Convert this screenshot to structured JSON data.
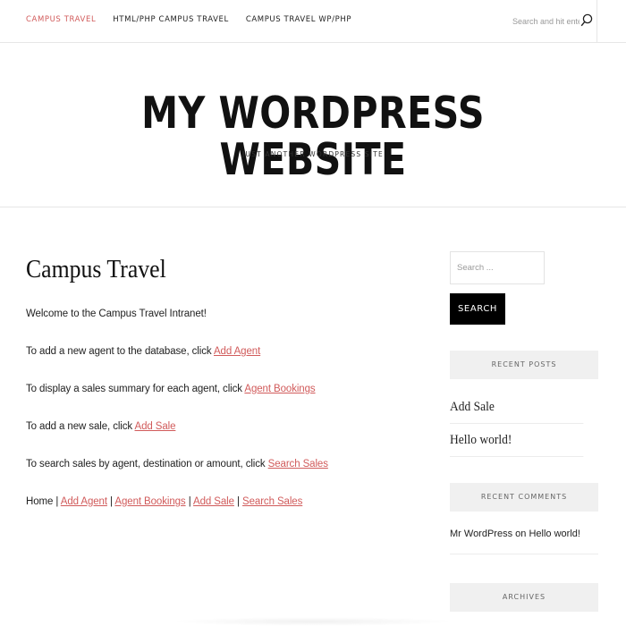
{
  "nav": {
    "items": [
      {
        "label": "CAMPUS TRAVEL",
        "active": true
      },
      {
        "label": "HTML/PHP CAMPUS TRAVEL",
        "active": false
      },
      {
        "label": "CAMPUS TRAVEL WP/PHP",
        "active": false
      }
    ],
    "search_placeholder": "Search and hit enter...",
    "search_icon": "search-icon"
  },
  "header": {
    "site_title": "MY WORDPRESS WEBSITE",
    "tagline": "JUST ANOTHER WORDPRESS SITE"
  },
  "main": {
    "title": "Campus Travel",
    "welcome": "Welcome to the Campus Travel Intranet!",
    "lines": [
      {
        "text": "To add a new agent to the database, click ",
        "link": "Add Agent"
      },
      {
        "text": "To display a sales summary for each agent, click ",
        "link": "Agent Bookings"
      },
      {
        "text": "To add a new sale, click ",
        "link": "Add Sale"
      },
      {
        "text": "To search sales by agent, destination or amount, click ",
        "link": "Search Sales"
      }
    ],
    "footer_nav": {
      "home": "Home",
      "separator": "|",
      "links": [
        "Add Agent",
        "Agent Bookings",
        "Add Sale",
        "Search Sales"
      ]
    }
  },
  "sidebar": {
    "search_placeholder": "Search ...",
    "search_button": "SEARCH",
    "recent_posts_title": "RECENT POSTS",
    "recent_posts": [
      "Add Sale",
      "Hello world!"
    ],
    "recent_comments_title": "RECENT COMMENTS",
    "comment": {
      "author": "Mr WordPress",
      "on": "on",
      "post": "Hello world!"
    },
    "archives_title": "ARCHIVES"
  },
  "colors": {
    "accent": "#d15b5b",
    "button_bg": "#000000",
    "widget_bg": "#f0f0f0"
  }
}
